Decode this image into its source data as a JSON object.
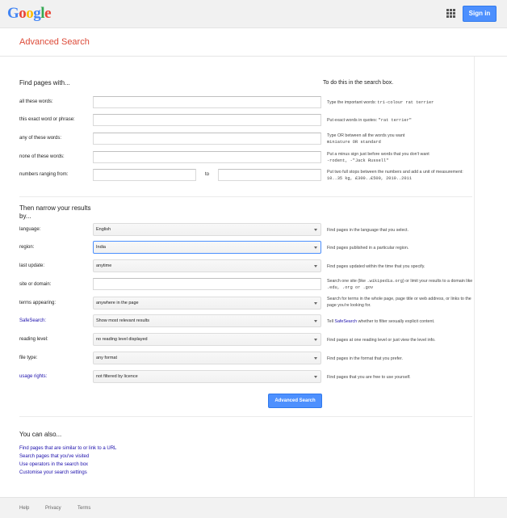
{
  "header": {
    "logo_letters": [
      {
        "ch": "G",
        "color": "#4285f4"
      },
      {
        "ch": "o",
        "color": "#ea4335"
      },
      {
        "ch": "o",
        "color": "#fbbc05"
      },
      {
        "ch": "g",
        "color": "#4285f4"
      },
      {
        "ch": "l",
        "color": "#34a853"
      },
      {
        "ch": "e",
        "color": "#ea4335"
      }
    ],
    "apps_icon": "apps-grid-icon",
    "signin_label": "Sign in"
  },
  "page_title": "Advanced Search",
  "find": {
    "heading": "Find pages with...",
    "hint_heading": "To do this in the search box.",
    "rows": [
      {
        "label": "all these words:",
        "value": "",
        "hint_pre": "Type the important words: ",
        "hint_code": "tri-colour rat terrier",
        "hint_post": ""
      },
      {
        "label": "this exact word or phrase:",
        "value": "",
        "hint_pre": "Put exact words in quotes: ",
        "hint_code": "\"rat terrier\"",
        "hint_post": ""
      },
      {
        "label": "any of these words:",
        "value": "",
        "hint_pre": "Type OR between all the words you want",
        "hint_code": "miniature OR standard",
        "hint_post": ""
      },
      {
        "label": "none of these words:",
        "value": "",
        "hint_pre": "Put a minus sign just before words that you don't want",
        "hint_code": "-rodent, -\"Jack Russell\"",
        "hint_post": ""
      },
      {
        "label": "numbers ranging from:",
        "value": "",
        "hint_pre": "Put two full stops between the numbers and add a unit of measurement: ",
        "hint_code": "10..35 kg, £300..£500, 2010..2011",
        "hint_post": ""
      }
    ],
    "range_to": "to"
  },
  "narrow": {
    "heading": "Then narrow your results by...",
    "rows": [
      {
        "label": "language:",
        "value": "English",
        "link": false,
        "hint": "Find pages in the language that you select."
      },
      {
        "label": "region:",
        "value": "India",
        "link": false,
        "hint": "Find pages published in a particular region."
      },
      {
        "label": "last update:",
        "value": "anytime",
        "link": false,
        "hint": "Find pages updated within the time that you specify."
      },
      {
        "label": "site or domain:",
        "value": "",
        "link": false,
        "hint": ""
      },
      {
        "label": "terms appearing:",
        "value": "anywhere in the page",
        "link": false,
        "hint": "Search for terms in the whole page, page title or web address, or links to the page you're looking for."
      },
      {
        "label": "SafeSearch:",
        "value": "Show most relevant results",
        "link": true,
        "hint": ""
      },
      {
        "label": "reading level:",
        "value": "no reading level displayed",
        "link": false,
        "hint": "Find pages at one reading level or just view the level info."
      },
      {
        "label": "file type:",
        "value": "any format",
        "link": false,
        "hint": "Find pages in the format that you prefer."
      },
      {
        "label": "usage rights:",
        "value": "not filtered by licence",
        "link": true,
        "hint": "Find pages that you are free to use yourself."
      }
    ],
    "site_hint_pre": "Search one site (like ",
    "site_hint_code1": ".wikipedia.org",
    "site_hint_mid": ") or limit your results to a domain like ",
    "site_hint_code2": ".edu, .org or .gov",
    "safe_hint_pre": "Tell ",
    "safe_hint_link": "SafeSearch",
    "safe_hint_post": " whether to filter sexually explicit content."
  },
  "submit_label": "Advanced Search",
  "also": {
    "heading": "You can also...",
    "links": [
      "Find pages that are similar to or link to a URL",
      "Search pages that you've visited",
      "Use operators in the search box",
      "Customise your search settings"
    ]
  },
  "footer": {
    "links": [
      "Help",
      "Privacy",
      "Terms"
    ]
  }
}
